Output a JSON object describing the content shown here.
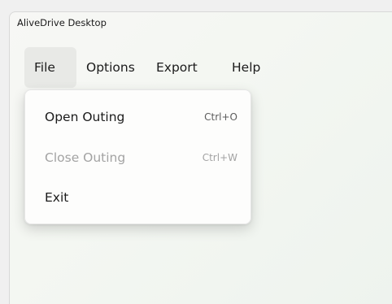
{
  "window": {
    "title": "AliveDrive Desktop"
  },
  "menubar": {
    "items": [
      {
        "label": "File",
        "active": true
      },
      {
        "label": "Options"
      },
      {
        "label": "Export"
      },
      {
        "label": "Help"
      }
    ]
  },
  "file_menu": {
    "items": [
      {
        "label": "Open Outing",
        "shortcut": "Ctrl+O",
        "enabled": true
      },
      {
        "label": "Close Outing",
        "shortcut": "Ctrl+W",
        "enabled": false
      },
      {
        "label": "Exit",
        "enabled": true
      }
    ]
  }
}
